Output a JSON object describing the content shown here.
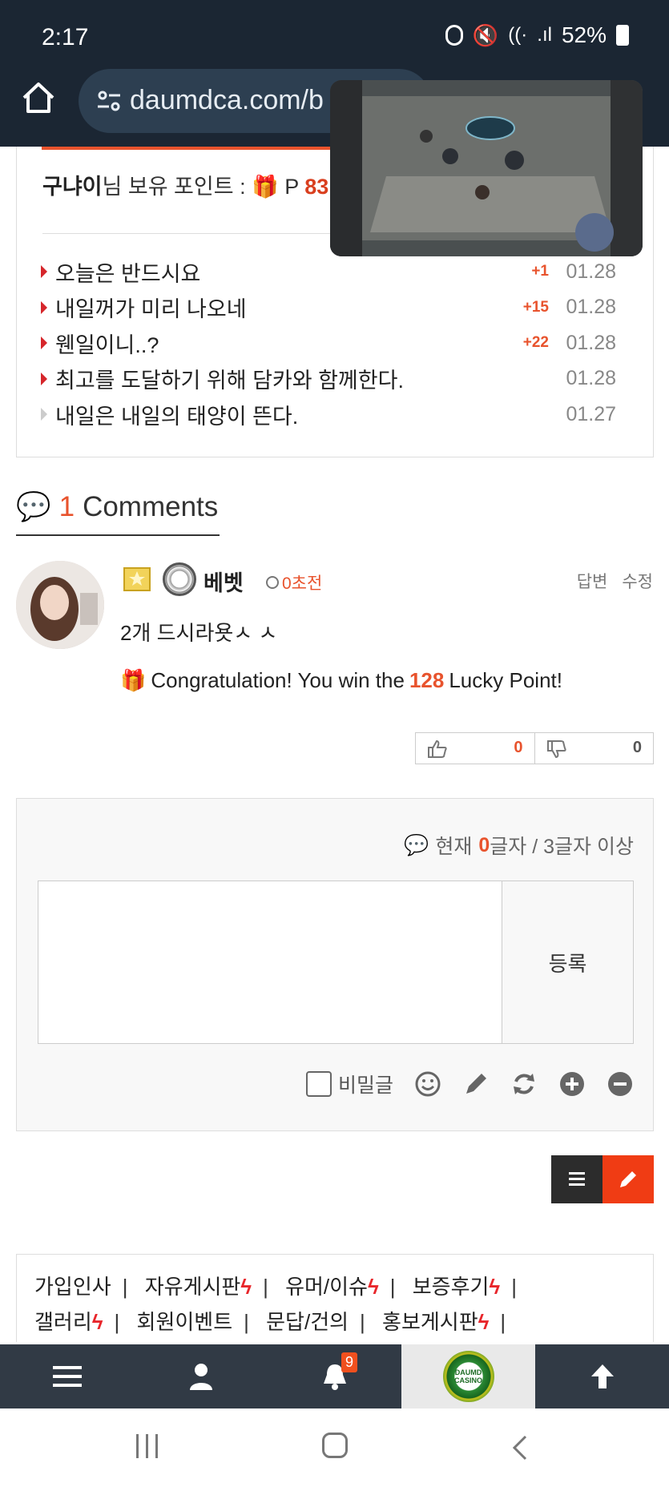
{
  "status_bar": {
    "time": "2:17",
    "battery": "52%"
  },
  "browser": {
    "url": "daumdca.com/b"
  },
  "user_info": {
    "username": "구냐이",
    "suffix": "님 보유 포인트 :",
    "point_prefix": "P",
    "point_value": "83,"
  },
  "feed": [
    {
      "title": "오늘은 반드시요",
      "plus": "+1",
      "date": "01.28",
      "active": true
    },
    {
      "title": "내일꺼가 미리 나오네",
      "plus": "+15",
      "date": "01.28",
      "active": true
    },
    {
      "title": "웬일이니..?",
      "plus": "+22",
      "date": "01.28",
      "active": true
    },
    {
      "title": "최고를 도달하기 위해 담카와 함께한다.",
      "plus": "",
      "date": "01.28",
      "active": true
    },
    {
      "title": "내일은 내일의 태양이 뜬다.",
      "plus": "",
      "date": "01.27",
      "active": false
    }
  ],
  "comments_header": {
    "count": "1",
    "label": "Comments"
  },
  "comment": {
    "author": "베벳",
    "time": "0초전",
    "reply_label": "답변",
    "edit_label": "수정",
    "text": "2개 드시라욧ㅅ ㅅ",
    "lucky_prefix": "Congratulation! You win the",
    "lucky_points": "128",
    "lucky_suffix": "Lucky Point!",
    "upvotes": "0",
    "downvotes": "0"
  },
  "form": {
    "count_label_before": "현재",
    "count_value": "0",
    "count_label_after": "글자 / 3글자 이상",
    "submit_label": "등록",
    "secret_label": "비밀글"
  },
  "footer_links": {
    "row1": [
      "가입인사",
      "자유게시판",
      "유머/이슈",
      "보증후기"
    ],
    "row2": [
      "갤러리",
      "회원이벤트",
      "문답/건의",
      "홍보게시판"
    ]
  },
  "bottom_nav": {
    "notification_count": "9",
    "logo_text": "DAUMD CASINO"
  },
  "colors": {
    "accent": "#e8532d",
    "header_bg": "#1b2633",
    "nav_bg": "#313a45",
    "write_button": "#f03c14"
  }
}
